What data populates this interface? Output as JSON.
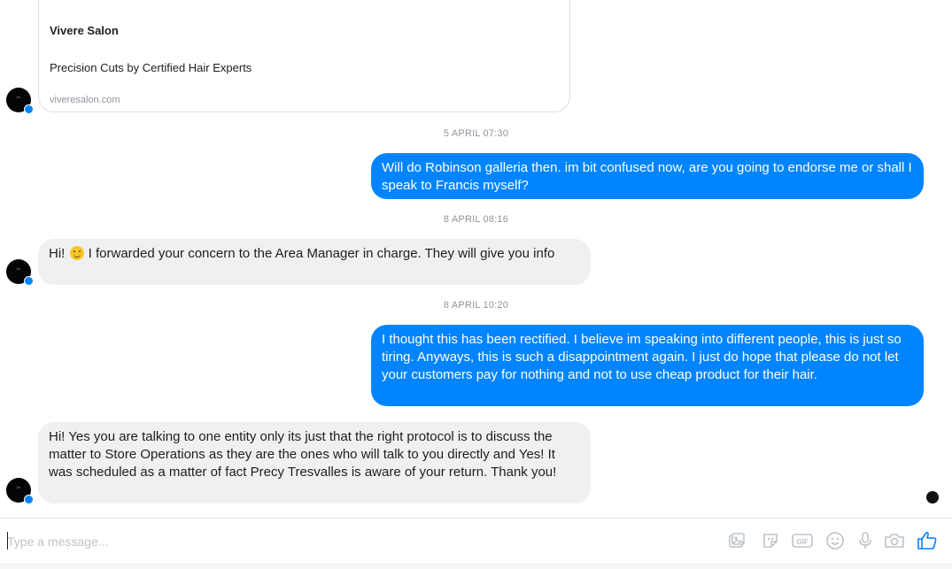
{
  "link_preview": {
    "title": "Vivere Salon",
    "description": "Precision Cuts by Certified Hair Experts",
    "url": "viveresalon.com"
  },
  "messages": [
    {
      "type": "timestamp",
      "text": "5 APRIL 07:30"
    },
    {
      "type": "outgoing",
      "text": "Will do Robinson galleria then. im  bit confused now, are you going to endorse  me or shall I speak to Francis myself?"
    },
    {
      "type": "timestamp",
      "text": "8 APRIL 08:16"
    },
    {
      "type": "incoming",
      "text_before_emoji": "Hi! ",
      "emoji": "slightly-smiling-face",
      "text_after_emoji": " I forwarded your concern to the Area Manager in charge. They will give you info"
    },
    {
      "type": "timestamp",
      "text": "8 APRIL 10:20"
    },
    {
      "type": "outgoing",
      "text": "I thought this has been rectified. I believe im speaking into different people, this is just so tiring. Anyways, this is such a disappointment again. I just do hope that please do not let your customers pay for nothing and not to use cheap product for their hair."
    },
    {
      "type": "incoming",
      "text": "Hi! Yes you are talking to one entity only its just that the right protocol is to discuss the matter to Store Operations as they are the ones who will talk to you directly and Yes! It was scheduled as a matter of fact Precy Tresvalles is aware of your return. Thank you!"
    }
  ],
  "composer": {
    "placeholder": "Type a message...",
    "tools": [
      "sticker-icon",
      "emoji-sticker-icon",
      "gif-icon",
      "emoji-icon",
      "microphone-icon",
      "camera-icon",
      "like-icon"
    ]
  },
  "colors": {
    "outgoing_bubble": "#0084ff",
    "incoming_bubble": "#f1f0f0",
    "timestamp": "#90949c"
  }
}
